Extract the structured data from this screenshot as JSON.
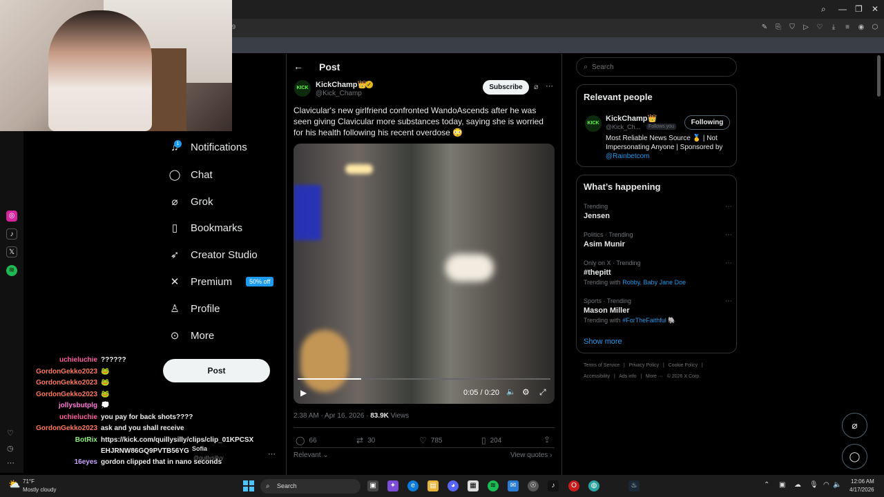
{
  "browser": {
    "tab_partial": "9",
    "tools": [
      "✎",
      "⎘",
      "⛉",
      "▷",
      "♡",
      "⤓",
      "≡",
      "◉",
      "⬡"
    ]
  },
  "colors": {
    "accent": "#1d9bf0",
    "bg": "#000000",
    "text": "#e7e9ea",
    "muted": "#71767b"
  },
  "nav": {
    "items": [
      {
        "label": "Notifications",
        "icon": "bell-icon",
        "glyph": "🔔",
        "badge": "1"
      },
      {
        "label": "Chat",
        "icon": "chat-icon",
        "glyph": "💬"
      },
      {
        "label": "Grok",
        "icon": "grok-icon",
        "glyph": "⌀"
      },
      {
        "label": "Bookmarks",
        "icon": "bookmark-icon",
        "glyph": "🔖"
      },
      {
        "label": "Creator Studio",
        "icon": "rocket-icon",
        "glyph": "🚀"
      },
      {
        "label": "Premium",
        "icon": "x-icon",
        "glyph": "𝕏",
        "tag": "50% off"
      },
      {
        "label": "Profile",
        "icon": "profile-icon",
        "glyph": "👤"
      },
      {
        "label": "More",
        "icon": "more-icon",
        "glyph": "⋯"
      }
    ],
    "post_button": "Post"
  },
  "chat": {
    "messages": [
      {
        "user": "uchieluchie",
        "color": "#ff5fa2",
        "text": "??????"
      },
      {
        "user": "GordonGekko2023",
        "color": "#ff7a5c",
        "text": "🐸"
      },
      {
        "user": "GordonGekko2023",
        "color": "#ff7a5c",
        "text": "🐸"
      },
      {
        "user": "GordonGekko2023",
        "color": "#ff7a5c",
        "text": "🐸"
      },
      {
        "user": "jollysbutplg",
        "color": "#ff7ad9",
        "text": "💭"
      },
      {
        "user": "uchieluchie",
        "color": "#ff5fa2",
        "text": "you pay for back shots????"
      },
      {
        "user": "GordonGekko2023",
        "color": "#ff7a5c",
        "text": "ask and you shall receive"
      },
      {
        "user": "BotRix",
        "color": "#8ef07a",
        "text": "https://kick.com/quillysilly/clips/clip_01KPCSX"
      },
      {
        "user": "",
        "color": "#8ef07a",
        "text": "EHJRNW86GQ9PVTB56YG"
      },
      {
        "user": "16eyes",
        "color": "#c9a4ff",
        "text": "gordon clipped that in nano seconds"
      }
    ],
    "overlay_name": "Sofia",
    "overlay_handle": "@quillysillyy"
  },
  "post": {
    "header": "Post",
    "author_name": "KickChamp👑",
    "author_handle": "@Kick_Champ",
    "subscribe": "Subscribe",
    "text": "Clavicular's new girlfriend confronted WandoAscends after he was seen giving Clavicular more substances today, saying she is worried for his health following his recent overdose 😳",
    "video_time": "0:05 / 0:20",
    "video_progress": 0.25,
    "timestamp": "2:38 AM · Apr 16, 2026 · ",
    "views_count": "83.9K",
    "views_label": " Views",
    "replies": "66",
    "reposts": "30",
    "likes": "785",
    "bookmarks": "204",
    "relevant": "Relevant ⌄",
    "view_quotes": "View quotes ›"
  },
  "search": {
    "placeholder": "Search"
  },
  "relevant_people": {
    "title": "Relevant people",
    "name": "KickChamp👑",
    "handle": "@Kick_Ch...",
    "follows_you": "Follows you",
    "following": "Following",
    "bio": "Most Reliable News Source 🥇 | Not Impersonating Anyone | Sponsored by",
    "bio_link": "@Rainbetcom"
  },
  "happening": {
    "title": "What’s happening",
    "trends": [
      {
        "context": "Trending",
        "name": "Jensen",
        "with": "",
        "links": ""
      },
      {
        "context": "Politics · Trending",
        "name": "Asim Munir",
        "with": "",
        "links": ""
      },
      {
        "context": "Only on X · Trending",
        "name": "#thepitt",
        "with": "Trending with ",
        "links": "Robby, Baby Jane Doe"
      },
      {
        "context": "Sports · Trending",
        "name": "Mason Miller",
        "with": "Trending with ",
        "links": "#ForTheFaithful 🐘"
      }
    ],
    "show_more": "Show more"
  },
  "footer": {
    "l1": "Terms of Service   |   Privacy Policy   |   Cookie Policy   |",
    "l2": "Accessibility   |   Ads info   |   More ···   © 2026 X Corp."
  },
  "taskbar": {
    "weather_temp": "71°F",
    "weather_desc": "Mostly cloudy",
    "search": "Search",
    "time": "12:06 AM",
    "date": "4/17/2026"
  }
}
